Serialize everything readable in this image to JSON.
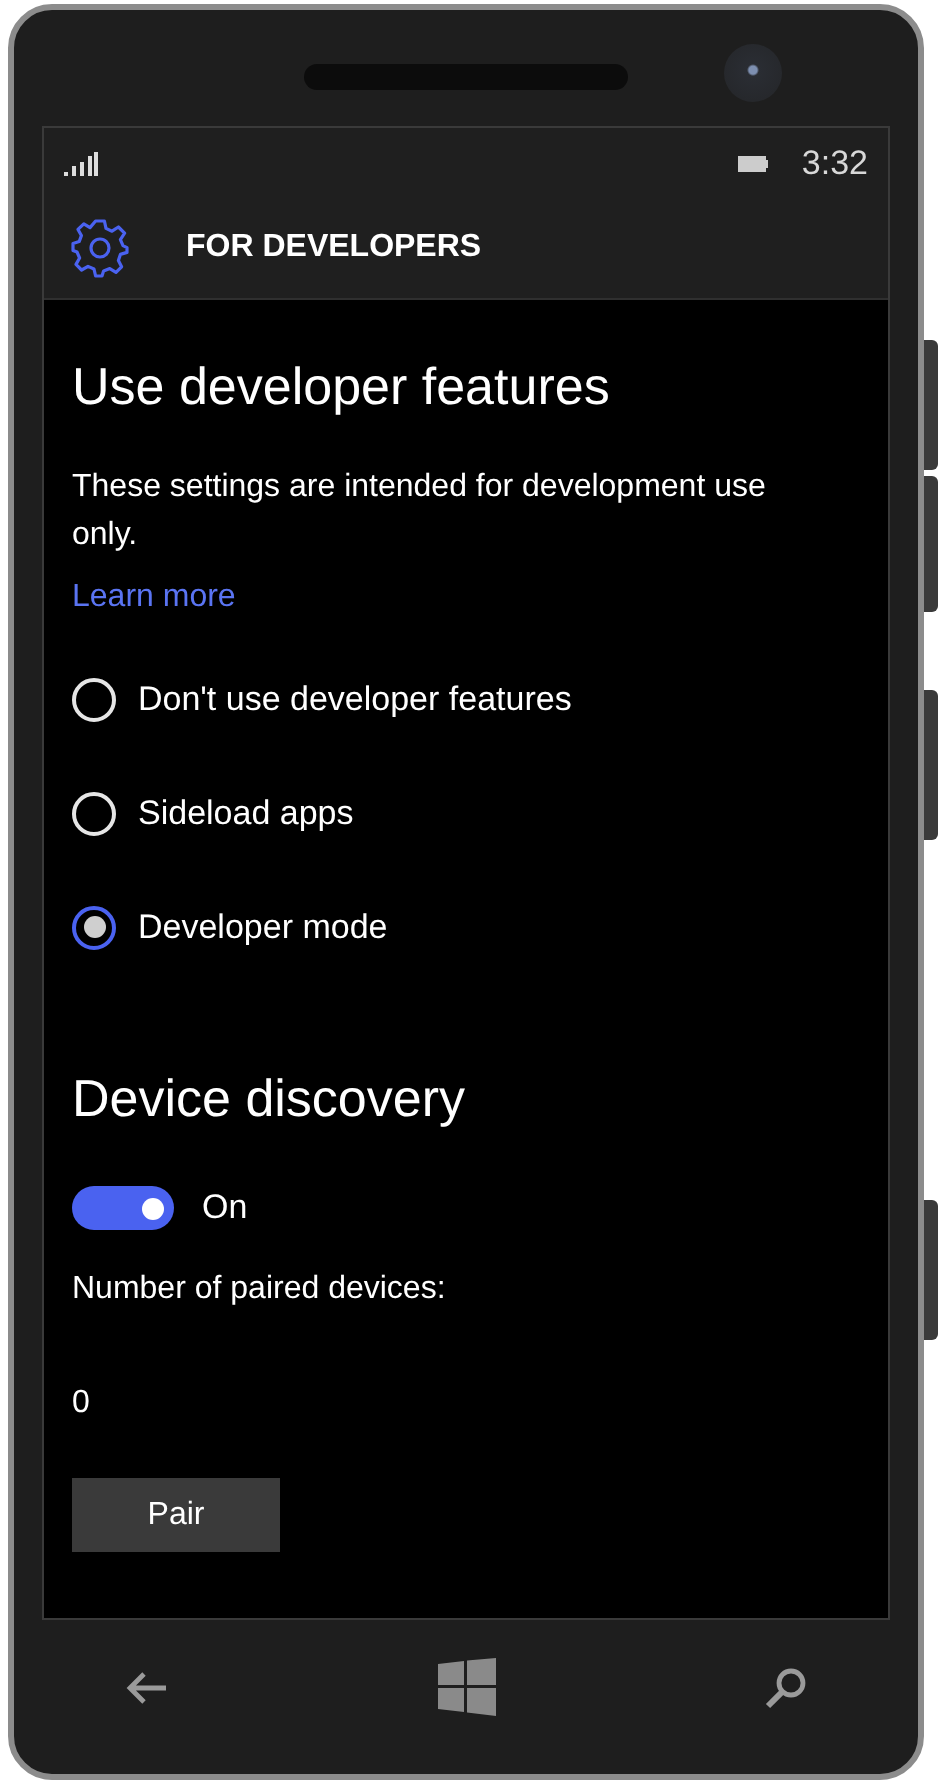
{
  "status_bar": {
    "time": "3:32"
  },
  "header": {
    "title": "FOR DEVELOPERS"
  },
  "developer_features": {
    "heading": "Use developer features",
    "description": "These settings are intended for development use only.",
    "link": "Learn more",
    "options": [
      {
        "label": "Don't use developer features",
        "selected": false
      },
      {
        "label": "Sideload apps",
        "selected": false
      },
      {
        "label": "Developer mode",
        "selected": true
      }
    ]
  },
  "device_discovery": {
    "heading": "Device discovery",
    "toggle": {
      "on": true,
      "label": "On"
    },
    "paired_label": "Number of paired devices:",
    "paired_count": "0",
    "button": "Pair"
  }
}
